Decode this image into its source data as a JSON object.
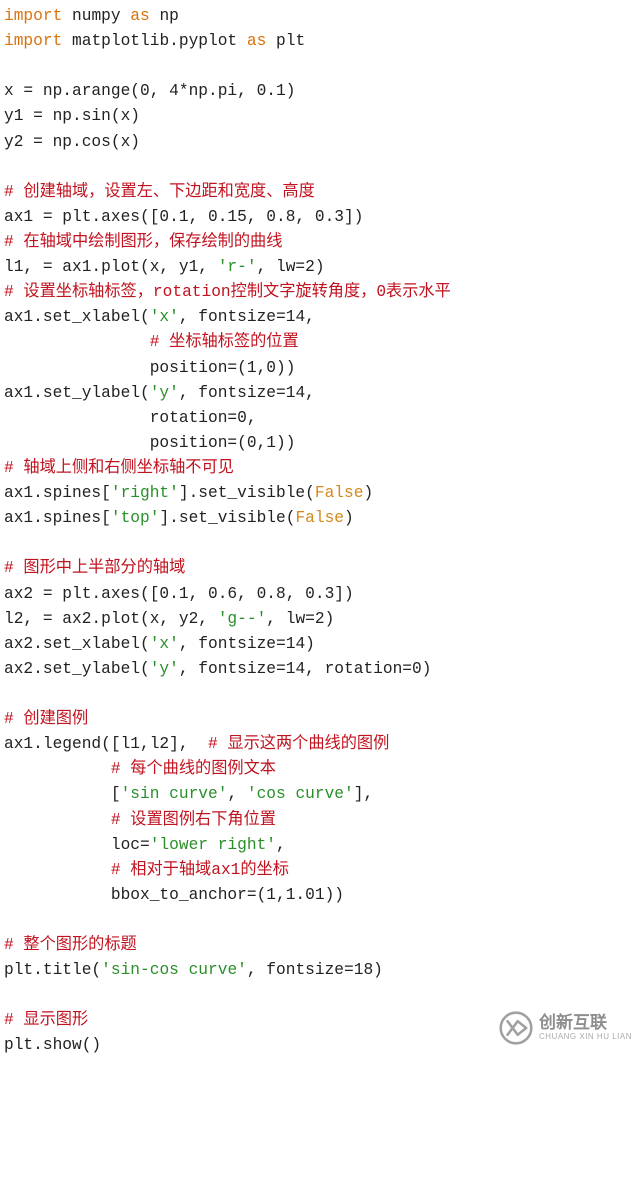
{
  "code": {
    "l1_import": "import",
    "l1_numpy": " numpy ",
    "l1_as": "as",
    "l1_np": " np",
    "l2_import": "import",
    "l2_mpl": " matplotlib.pyplot ",
    "l2_as": "as",
    "l2_plt": " plt",
    "blank1": "",
    "l3": "x = np.arange(0, 4*np.pi, 0.1)",
    "l4": "y1 = np.sin(x)",
    "l5": "y2 = np.cos(x)",
    "blank2": "",
    "c1": "# 创建轴域，设置左、下边距和宽度、高度",
    "l6": "ax1 = plt.axes([0.1, 0.15, 0.8, 0.3])",
    "c2": "# 在轴域中绘制图形，保存绘制的曲线",
    "l7a": "l1, = ax1.plot(x, y1, ",
    "l7s": "'r-'",
    "l7b": ", lw=2)",
    "c3": "# 设置坐标轴标签，rotation控制文字旋转角度，0表示水平",
    "l8a": "ax1.set_xlabel(",
    "l8s": "'x'",
    "l8b": ", fontsize=14,",
    "c4pre": "               ",
    "c4": "# 坐标轴标签的位置",
    "l9": "               position=(1,0))",
    "l10a": "ax1.set_ylabel(",
    "l10s": "'y'",
    "l10b": ", fontsize=14,",
    "l11": "               rotation=0,",
    "l12": "               position=(0,1))",
    "c5": "# 轴域上侧和右侧坐标轴不可见",
    "l13a": "ax1.spines[",
    "l13s": "'right'",
    "l13b": "].set_visible(",
    "l13f": "False",
    "l13c": ")",
    "l14a": "ax1.spines[",
    "l14s": "'top'",
    "l14b": "].set_visible(",
    "l14f": "False",
    "l14c": ")",
    "blank3": "",
    "c6": "# 图形中上半部分的轴域",
    "l15": "ax2 = plt.axes([0.1, 0.6, 0.8, 0.3])",
    "l16a": "l2, = ax2.plot(x, y2, ",
    "l16s": "'g--'",
    "l16b": ", lw=2)",
    "l17a": "ax2.set_xlabel(",
    "l17s": "'x'",
    "l17b": ", fontsize=14)",
    "l18a": "ax2.set_ylabel(",
    "l18s": "'y'",
    "l18b": ", fontsize=14, rotation=0)",
    "blank4": "",
    "c7": "# 创建图例",
    "l19a": "ax1.legend([l1,l2],  ",
    "c8": "# 显示这两个曲线的图例",
    "l20pre": "           ",
    "c9": "# 每个曲线的图例文本",
    "l21pre": "           [",
    "l21s1": "'sin curve'",
    "l21m": ", ",
    "l21s2": "'cos curve'",
    "l21b": "],",
    "l22pre": "           ",
    "c10": "# 设置图例右下角位置",
    "l23pre": "           loc=",
    "l23s": "'lower right'",
    "l23b": ",",
    "l24pre": "           ",
    "c11": "# 相对于轴域ax1的坐标",
    "l25": "           bbox_to_anchor=(1,1.01))",
    "blank5": "",
    "c12": "# 整个图形的标题",
    "l26a": "plt.title(",
    "l26s": "'sin-cos curve'",
    "l26b": ", fontsize=18)",
    "blank6": "",
    "c13": "# 显示图形",
    "l27": "plt.show()"
  },
  "watermark": {
    "cn": "创新互联",
    "en": "CHUANG XIN HU LIAN"
  }
}
